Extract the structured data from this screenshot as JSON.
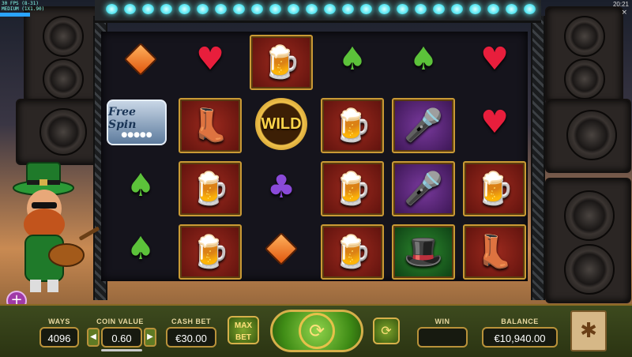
{
  "hud": {
    "fps_line1": "30 FPS (8-31)",
    "fps_line2": "MEDIUM (1X1.90)",
    "clock": "20:21",
    "close_glyph": "×"
  },
  "reels": {
    "grid": [
      [
        "",
        "free-spin",
        "spade",
        "spade",
        ""
      ],
      [
        "heart",
        "boots",
        "beer",
        "beer",
        ""
      ],
      [
        "beer",
        "wild",
        "club",
        "diamond",
        ""
      ],
      [
        "spade",
        "beer",
        "beer",
        "beer",
        ""
      ],
      [
        "spade",
        "microphone",
        "microphone",
        "hat-coins",
        ""
      ],
      [
        "heart",
        "heart",
        "beer",
        "boots",
        ""
      ]
    ],
    "free_spin_text": "Free Spin",
    "wild_text": "WILD"
  },
  "controls": {
    "ways_label": "WAYS",
    "ways_value": "4096",
    "coin_value_label": "COIN VALUE",
    "coin_value": "0.60",
    "cash_bet_label": "CASH BET",
    "cash_bet_value": "€30.00",
    "max_bet_line1": "MAX",
    "max_bet_line2": "BET",
    "win_label": "WIN",
    "win_value": "",
    "balance_label": "BALANCE",
    "balance_value": "€10,940.00",
    "minus_glyph": "◀",
    "plus_glyph": "▶",
    "spin_glyph": "⟳",
    "autoplay_glyph": "⟳",
    "menu_glyph": "✱",
    "extra_glyph": "+"
  },
  "icons": {
    "heart": "♥",
    "spade": "♠",
    "club": "♣",
    "beer": "🍺",
    "boots": "👢",
    "microphone": "🎤",
    "hat-coins": "🎩"
  },
  "colors": {
    "heart": "#e81e3c",
    "spade": "#5cc23a",
    "club": "#8a4ad8",
    "gold": "#d6b04a"
  }
}
